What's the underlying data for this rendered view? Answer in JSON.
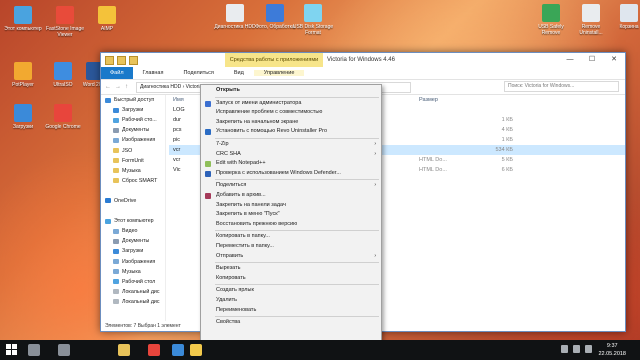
{
  "desktop_icons": [
    {
      "label": "Этот компьютер",
      "color": "#4aa3df"
    },
    {
      "label": "FastStone Image Viewer",
      "color": "#e84b3a"
    },
    {
      "label": "AIMP",
      "color": "#f4c23a"
    },
    {
      "label": "Диагностика HDD",
      "color": "#e9ecef"
    },
    {
      "label": "Фото, Обработка",
      "color": "#3d7bd9"
    },
    {
      "label": "USB Disk Storage Format",
      "color": "#7fd4f0"
    },
    {
      "label": "USB Safely Remove",
      "color": "#3aa657"
    },
    {
      "label": "Remove Uninstall...",
      "color": "#e9ecef"
    },
    {
      "label": "Корзина",
      "color": "#dfe6ee"
    },
    {
      "label": "PotPlayer",
      "color": "#f2a930"
    },
    {
      "label": "UltraISO",
      "color": "#3e8de0"
    },
    {
      "label": "Word 2016",
      "color": "#2b579a"
    },
    {
      "label": "Загрузки",
      "color": "#3b8ad9"
    },
    {
      "label": "Google Chrome",
      "color": "#e8453c"
    }
  ],
  "window": {
    "title": "Victoria for Windows 4.46",
    "tools_context_tab": "Средства работы с приложениями",
    "ribbon_tabs": [
      "Файл",
      "Главная",
      "Поделиться",
      "Вид",
      "Управление"
    ],
    "address": "Диагностика HDD › Victoria for Windows 4.46",
    "search_placeholder": "Поиск: Victoria for Windows...",
    "minimize": "—",
    "maximize": "☐",
    "close": "✕",
    "back": "←",
    "forward": "→",
    "up": "↑",
    "status": "Элементов: 7   Выбран 1 элемент"
  },
  "nav_pane": [
    {
      "label": "Быстрый доступ",
      "color": "#3b8ad9"
    },
    {
      "label": "Загрузки",
      "color": "#3b8ad9"
    },
    {
      "label": "Рабочий сто...",
      "color": "#4fa3e0"
    },
    {
      "label": "Документы",
      "color": "#8a9bb1"
    },
    {
      "label": "Изображения",
      "color": "#7aa9d6"
    },
    {
      "label": "JSO",
      "color": "#e8c35a"
    },
    {
      "label": "FormUnit",
      "color": "#e8c35a"
    },
    {
      "label": "Музыка",
      "color": "#e8c35a"
    },
    {
      "label": "Сброс SMART",
      "color": "#e8c35a"
    },
    {
      "label": "",
      "color": "transparent"
    },
    {
      "label": "OneDrive",
      "color": "#2b7cd3"
    },
    {
      "label": "",
      "color": "transparent"
    },
    {
      "label": "Этот компьютер",
      "color": "#4aa3df"
    },
    {
      "label": "Видео",
      "color": "#7aa9d6"
    },
    {
      "label": "Документы",
      "color": "#8a9bb1"
    },
    {
      "label": "Загрузки",
      "color": "#3b8ad9"
    },
    {
      "label": "Изображения",
      "color": "#7aa9d6"
    },
    {
      "label": "Музыка",
      "color": "#7aa9d6"
    },
    {
      "label": "Рабочий стол",
      "color": "#4fa3e0"
    },
    {
      "label": "Локальный дис",
      "color": "#b0b8c0"
    },
    {
      "label": "Локальный дис",
      "color": "#b0b8c0"
    }
  ],
  "columns": {
    "name": "Имя",
    "size": "Размер"
  },
  "files": [
    {
      "name": "LOG",
      "type": "",
      "size": "",
      "selected": false
    },
    {
      "name": "dur",
      "type": "",
      "size": "1 КБ",
      "selected": false
    },
    {
      "name": "pcs",
      "type": "",
      "size": "4 КБ",
      "selected": false
    },
    {
      "name": "pic",
      "type": "",
      "size": "1 КБ",
      "selected": false
    },
    {
      "name": "vcr",
      "type": "",
      "size": "534 КБ",
      "selected": true
    },
    {
      "name": "vcr",
      "type": "HTML Do...",
      "size": "5 КБ",
      "selected": false
    },
    {
      "name": "Vic",
      "type": "HTML Do...",
      "size": "6 КБ",
      "selected": false
    }
  ],
  "context_menu": [
    {
      "label": "Открыть",
      "bold": true,
      "arrow": false,
      "icon": ""
    },
    {
      "label": "Запуск от имени администратора",
      "bold": false,
      "arrow": false,
      "icon": "#3b6fd0"
    },
    {
      "label": "Исправление проблем с совместимостью",
      "bold": false,
      "arrow": false,
      "icon": ""
    },
    {
      "label": "Закрепить на начальном экране",
      "bold": false,
      "arrow": false,
      "icon": ""
    },
    {
      "label": "Установить с помощью Revo Uninstaller Pro",
      "bold": false,
      "arrow": false,
      "icon": "#2b6cc4"
    },
    {
      "label": "7-Zip",
      "bold": false,
      "arrow": true,
      "icon": ""
    },
    {
      "label": "CRC SHA",
      "bold": false,
      "arrow": true,
      "icon": ""
    },
    {
      "label": "Edit with Notepad++",
      "bold": false,
      "arrow": false,
      "icon": "#8fbf5a"
    },
    {
      "label": "Проверка с использованием Windows Defender...",
      "bold": false,
      "arrow": false,
      "icon": "#2d62b8"
    },
    {
      "label": "Поделиться",
      "bold": false,
      "arrow": true,
      "icon": ""
    },
    {
      "label": "Добавить в архив...",
      "bold": false,
      "arrow": false,
      "icon": "#a53a5a"
    },
    {
      "label": "Закрепить на панели задач",
      "bold": false,
      "arrow": false,
      "icon": ""
    },
    {
      "label": "Закрепить в меню \"Пуск\"",
      "bold": false,
      "arrow": false,
      "icon": ""
    },
    {
      "label": "Восстановить прежнюю версию",
      "bold": false,
      "arrow": false,
      "icon": ""
    },
    {
      "label": "Копировать в папку...",
      "bold": false,
      "arrow": false,
      "icon": ""
    },
    {
      "label": "Переместить в папку...",
      "bold": false,
      "arrow": false,
      "icon": ""
    },
    {
      "label": "Отправить",
      "bold": false,
      "arrow": true,
      "icon": ""
    },
    {
      "label": "Вырезать",
      "bold": false,
      "arrow": false,
      "icon": ""
    },
    {
      "label": "Копировать",
      "bold": false,
      "arrow": false,
      "icon": ""
    },
    {
      "label": "Создать ярлык",
      "bold": false,
      "arrow": false,
      "icon": ""
    },
    {
      "label": "Удалить",
      "bold": false,
      "arrow": false,
      "icon": ""
    },
    {
      "label": "Переименовать",
      "bold": false,
      "arrow": false,
      "icon": ""
    },
    {
      "label": "Свойства",
      "bold": false,
      "arrow": false,
      "icon": ""
    }
  ],
  "taskbar": {
    "start_icon": "windows-logo-icon",
    "time": "9:37",
    "date": "22.05.2018",
    "apps": [
      {
        "name": "search-icon",
        "color": "#8a9099"
      },
      {
        "name": "task-view-icon",
        "color": "#8a9099"
      },
      {
        "name": "explorer-taskbar-icon",
        "color": "#e8c35a"
      },
      {
        "name": "chrome-taskbar-icon",
        "color": "#e8453c"
      },
      {
        "name": "store-taskbar-icon",
        "color": "#3b8ad9"
      },
      {
        "name": "file-explorer-active-icon",
        "color": "#f2c94c"
      }
    ]
  }
}
